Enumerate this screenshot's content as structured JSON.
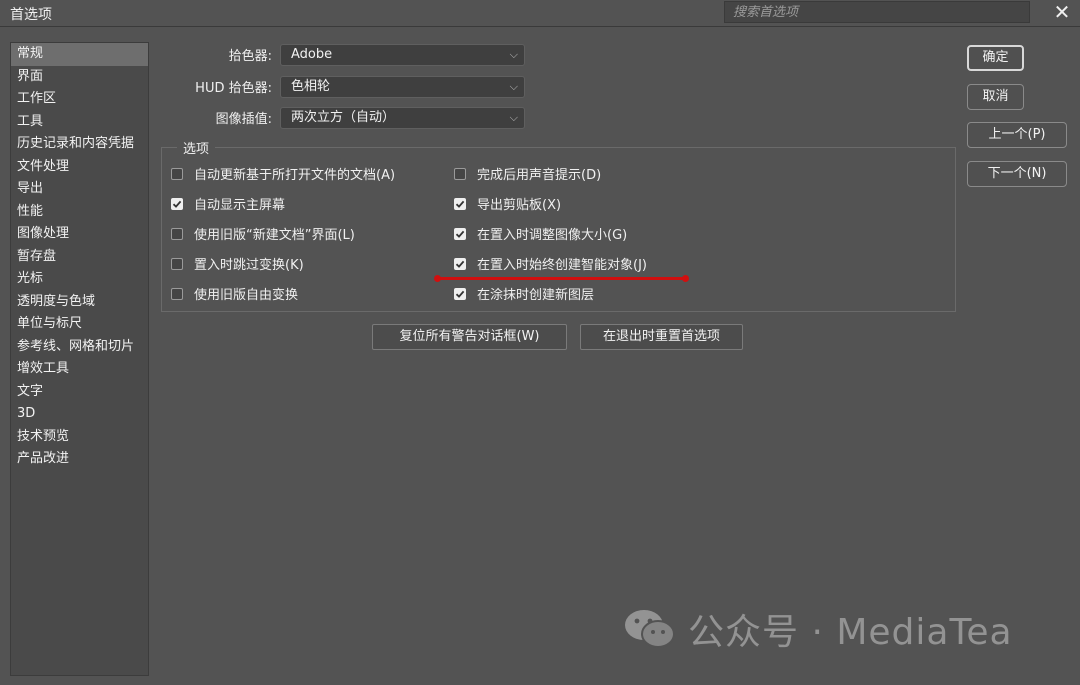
{
  "window": {
    "title": "首选项"
  },
  "search": {
    "placeholder": "搜索首选项"
  },
  "sidebar": {
    "items": [
      {
        "label": "常规",
        "active": true
      },
      {
        "label": "界面"
      },
      {
        "label": "工作区"
      },
      {
        "label": "工具"
      },
      {
        "label": "历史记录和内容凭据"
      },
      {
        "label": "文件处理"
      },
      {
        "label": "导出"
      },
      {
        "label": "性能"
      },
      {
        "label": "图像处理"
      },
      {
        "label": "暂存盘"
      },
      {
        "label": "光标"
      },
      {
        "label": "透明度与色域"
      },
      {
        "label": "单位与标尺"
      },
      {
        "label": "参考线、网格和切片"
      },
      {
        "label": "增效工具"
      },
      {
        "label": "文字"
      },
      {
        "label": "3D"
      },
      {
        "label": "技术预览"
      },
      {
        "label": "产品改进"
      }
    ]
  },
  "fields": {
    "color_picker": {
      "label": "拾色器:",
      "value": "Adobe"
    },
    "hud_color_picker": {
      "label": "HUD 拾色器:",
      "value": "色相轮"
    },
    "interpolation": {
      "label": "图像插值:",
      "value": "两次立方（自动）"
    }
  },
  "options": {
    "legend": "选项",
    "left": [
      {
        "label": "自动更新基于所打开文件的文档(A)",
        "checked": false
      },
      {
        "label": "自动显示主屏幕",
        "checked": true
      },
      {
        "label": "使用旧版“新建文档”界面(L)",
        "checked": false
      },
      {
        "label": "置入时跳过变换(K)",
        "checked": false
      },
      {
        "label": "使用旧版自由变换",
        "checked": false
      }
    ],
    "right": [
      {
        "label": "完成后用声音提示(D)",
        "checked": false
      },
      {
        "label": "导出剪贴板(X)",
        "checked": true
      },
      {
        "label": "在置入时调整图像大小(G)",
        "checked": true
      },
      {
        "label": "在置入时始终创建智能对象(J)",
        "checked": true
      },
      {
        "label": "在涂抹时创建新图层",
        "checked": true
      }
    ]
  },
  "buttons": {
    "ok": "确定",
    "cancel": "取消",
    "prev": "上一个(P)",
    "next": "下一个(N)",
    "reset_warnings": "复位所有警告对话框(W)",
    "reset_prefs": "在退出时重置首选项"
  },
  "annotation": {
    "color": "#d10f0f"
  },
  "watermark": {
    "text": "公众号 · MediaTea"
  }
}
